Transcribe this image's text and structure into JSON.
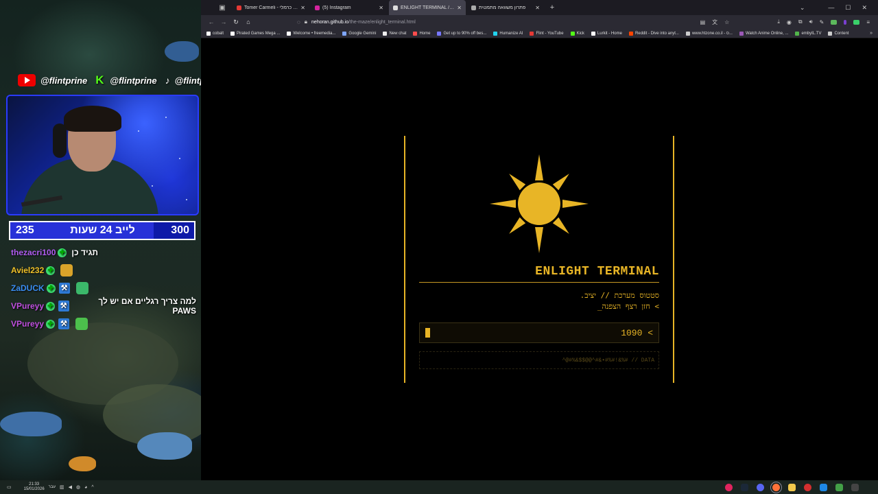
{
  "overlay": {
    "socials": [
      {
        "platform_icon": "youtube-icon",
        "handle": "@flintprine"
      },
      {
        "platform_icon": "kick-icon",
        "handle": "@flintprine"
      },
      {
        "platform_icon": "tiktok-icon",
        "handle": "@flintprine"
      }
    ],
    "counter": {
      "left_value": "235",
      "label": "לייב 24 שעות",
      "right_value": "300",
      "progress": 0.78
    },
    "chat": [
      {
        "user": "thezacri100",
        "color": "#b05cf0",
        "text": "תגיד כן",
        "emote_color": ""
      },
      {
        "user": "Aviel232",
        "color": "#f0c028",
        "text": "",
        "emote_color": "#d9a32a"
      },
      {
        "user": "ZaDUCK",
        "color": "#3a8cf0",
        "text": "",
        "emote_color": "#3bb86a"
      },
      {
        "user": "VPureyy",
        "color": "#c050e0",
        "text": "למה צריך רגליים אם יש לך PAWS",
        "emote_color": ""
      },
      {
        "user": "VPureyy",
        "color": "#c050e0",
        "text": "",
        "emote_color": "#4cc04c"
      }
    ]
  },
  "browser": {
    "tabs": [
      {
        "title": "Tomer Carmeli - תומר כרמלי - Y",
        "favicon_color": "#e53935",
        "active": false
      },
      {
        "title": "(5) Instagram",
        "favicon_color": "#d6249f",
        "active": false
      },
      {
        "title": "ENLIGHT TERMINAL / אנליגיט",
        "favicon_color": "#dddddd",
        "active": true
      },
      {
        "title": "פתרון משוואה מתמטית",
        "favicon_color": "#aaaaaa",
        "active": false
      }
    ],
    "url_host": "nehoran.github.io",
    "url_path": "/the-maze/enlight_terminal.html",
    "bookmarks": [
      {
        "label": "cobalt",
        "color": "#ffffff"
      },
      {
        "label": "Pirated Games Mega ...",
        "color": "#ffffff"
      },
      {
        "label": "Welcome • freemedia...",
        "color": "#ffffff"
      },
      {
        "label": "Google Gemini",
        "color": "#7fa6ff"
      },
      {
        "label": "New chat",
        "color": "#eeeeee"
      },
      {
        "label": "Home",
        "color": "#ff4d4d"
      },
      {
        "label": "Get up to 90% off bes...",
        "color": "#7777ff"
      },
      {
        "label": "Humanize AI",
        "color": "#22d3ee"
      },
      {
        "label": "Flint - YouTube",
        "color": "#e53935"
      },
      {
        "label": "Kick",
        "color": "#53fc18"
      },
      {
        "label": "Lurkit - Home",
        "color": "#ffffff"
      },
      {
        "label": "Reddit - Dive into anyt...",
        "color": "#ff4500"
      },
      {
        "label": "www.htzone.co.il - ס...",
        "color": "#cccccc"
      },
      {
        "label": "Watch Anime Online, ...",
        "color": "#9b59b6"
      },
      {
        "label": "embyIL.TV",
        "color": "#52b54b"
      },
      {
        "label": "Content",
        "color": "#cccccc"
      }
    ]
  },
  "terminal": {
    "accent": "#e8b526",
    "title": "ENLIGHT TERMINAL",
    "status_line": "סטטוס מערכת // יציב.",
    "prompt_line": "> חזן רצף הצפנה_",
    "input_value": "1090 <",
    "data_line": "^@#%&$$@@^#&•#%#!&%# // DATA"
  },
  "taskbar": {
    "time": "21:33",
    "date": "15/01/2026",
    "lang": "עבר"
  }
}
